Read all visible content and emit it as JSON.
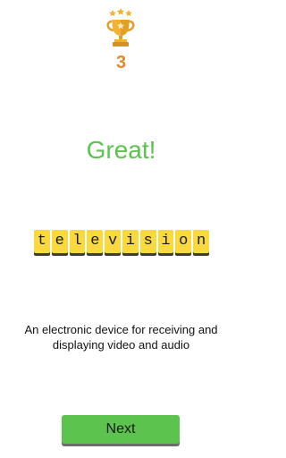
{
  "result": {
    "trophy_icon": "trophy-icon",
    "score": "3",
    "headline": "Great!"
  },
  "word": {
    "letters": [
      "t",
      "e",
      "l",
      "e",
      "v",
      "i",
      "s",
      "i",
      "o",
      "n"
    ]
  },
  "definition": "An electronic device for receiving and displaying video and audio",
  "actions": {
    "next_label": "Next"
  },
  "colors": {
    "accent_green": "#5cc34f",
    "score_orange": "#e5872a",
    "tile_yellow": "#f8d93e",
    "trophy_gold": "#f3b233"
  }
}
